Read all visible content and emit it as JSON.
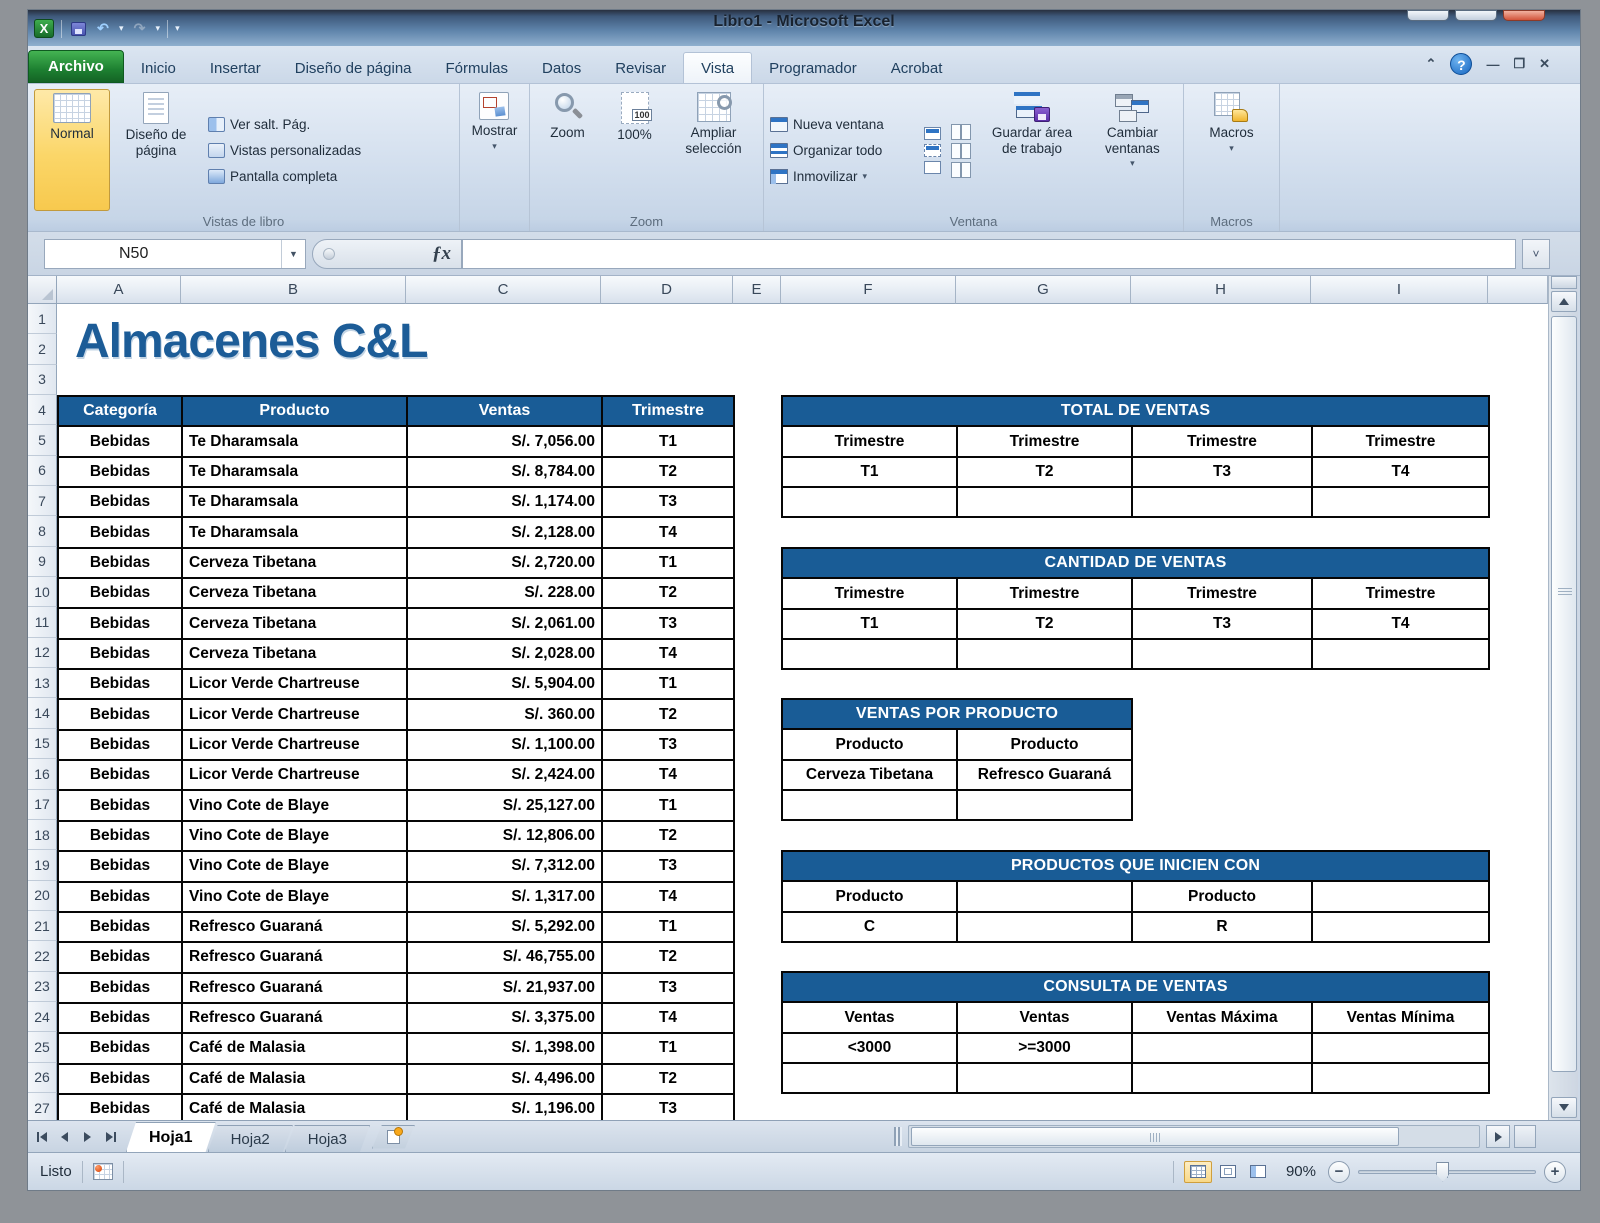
{
  "window": {
    "title": "Libro1 - Microsoft Excel"
  },
  "ribbon": {
    "tabs": [
      "Archivo",
      "Inicio",
      "Insertar",
      "Diseño de página",
      "Fórmulas",
      "Datos",
      "Revisar",
      "Vista",
      "Programador",
      "Acrobat"
    ],
    "active_tab": "Vista",
    "vistas_group": {
      "label": "Vistas de libro",
      "normal": "Normal",
      "diseno": "Diseño de página",
      "ver_salt": "Ver salt. Pág.",
      "vistas_pers": "Vistas personalizadas",
      "pantalla": "Pantalla completa"
    },
    "mostrar_group": {
      "button": "Mostrar"
    },
    "zoom_group": {
      "label": "Zoom",
      "zoom": "Zoom",
      "pct": "100%",
      "ampliar": "Ampliar selección"
    },
    "ventana_group": {
      "label": "Ventana",
      "nueva": "Nueva ventana",
      "organizar": "Organizar todo",
      "inmovilizar": "Inmovilizar",
      "guardar": "Guardar área de trabajo",
      "cambiar": "Cambiar ventanas"
    },
    "macros_group": {
      "label": "Macros",
      "button": "Macros"
    }
  },
  "formula_bar": {
    "name_box": "N50",
    "fx": "ƒx",
    "formula_value": ""
  },
  "grid": {
    "columns": [
      "A",
      "B",
      "C",
      "D",
      "E",
      "F",
      "G",
      "H",
      "I"
    ],
    "row_numbers": [
      1,
      2,
      3,
      4,
      5,
      6,
      7,
      8,
      9,
      10,
      11,
      12,
      13,
      14,
      15,
      16,
      17,
      18,
      19,
      20,
      21,
      22,
      23,
      24,
      25,
      26,
      27
    ]
  },
  "sheet": {
    "title": "Almacenes C&L",
    "main_table": {
      "columns": [
        "Categoría",
        "Producto",
        "Ventas",
        "Trimestre"
      ],
      "rows": [
        [
          "Bebidas",
          "Te Dharamsala",
          "S/. 7,056.00",
          "T1"
        ],
        [
          "Bebidas",
          "Te Dharamsala",
          "S/. 8,784.00",
          "T2"
        ],
        [
          "Bebidas",
          "Te Dharamsala",
          "S/. 1,174.00",
          "T3"
        ],
        [
          "Bebidas",
          "Te Dharamsala",
          "S/. 2,128.00",
          "T4"
        ],
        [
          "Bebidas",
          "Cerveza Tibetana",
          "S/. 2,720.00",
          "T1"
        ],
        [
          "Bebidas",
          "Cerveza Tibetana",
          "S/. 228.00",
          "T2"
        ],
        [
          "Bebidas",
          "Cerveza Tibetana",
          "S/. 2,061.00",
          "T3"
        ],
        [
          "Bebidas",
          "Cerveza Tibetana",
          "S/. 2,028.00",
          "T4"
        ],
        [
          "Bebidas",
          "Licor Verde Chartreuse",
          "S/. 5,904.00",
          "T1"
        ],
        [
          "Bebidas",
          "Licor Verde Chartreuse",
          "S/. 360.00",
          "T2"
        ],
        [
          "Bebidas",
          "Licor Verde Chartreuse",
          "S/. 1,100.00",
          "T3"
        ],
        [
          "Bebidas",
          "Licor Verde Chartreuse",
          "S/. 2,424.00",
          "T4"
        ],
        [
          "Bebidas",
          "Vino Cote de Blaye",
          "S/. 25,127.00",
          "T1"
        ],
        [
          "Bebidas",
          "Vino Cote de Blaye",
          "S/. 12,806.00",
          "T2"
        ],
        [
          "Bebidas",
          "Vino Cote de Blaye",
          "S/. 7,312.00",
          "T3"
        ],
        [
          "Bebidas",
          "Vino Cote de Blaye",
          "S/. 1,317.00",
          "T4"
        ],
        [
          "Bebidas",
          "Refresco Guaraná",
          "S/. 5,292.00",
          "T1"
        ],
        [
          "Bebidas",
          "Refresco Guaraná",
          "S/. 46,755.00",
          "T2"
        ],
        [
          "Bebidas",
          "Refresco Guaraná",
          "S/. 21,937.00",
          "T3"
        ],
        [
          "Bebidas",
          "Refresco Guaraná",
          "S/. 3,375.00",
          "T4"
        ],
        [
          "Bebidas",
          "Café de Malasia",
          "S/. 1,398.00",
          "T1"
        ],
        [
          "Bebidas",
          "Café de Malasia",
          "S/. 4,496.00",
          "T2"
        ],
        [
          "Bebidas",
          "Café de Malasia",
          "S/. 1,196.00",
          "T3"
        ]
      ]
    },
    "total_de_ventas": {
      "title": "TOTAL DE VENTAS",
      "columns": [
        "Trimestre",
        "Trimestre",
        "Trimestre",
        "Trimestre"
      ],
      "rows": [
        [
          "T1",
          "T2",
          "T3",
          "T4"
        ],
        [
          "",
          "",
          "",
          ""
        ]
      ]
    },
    "cantidad_de_ventas": {
      "title": "CANTIDAD DE VENTAS",
      "columns": [
        "Trimestre",
        "Trimestre",
        "Trimestre",
        "Trimestre"
      ],
      "rows": [
        [
          "T1",
          "T2",
          "T3",
          "T4"
        ],
        [
          "",
          "",
          "",
          ""
        ]
      ]
    },
    "ventas_por_producto": {
      "title": "VENTAS POR PRODUCTO",
      "columns": [
        "Producto",
        "Producto"
      ],
      "rows": [
        [
          "Cerveza Tibetana",
          "Refresco Guaraná"
        ],
        [
          "",
          ""
        ]
      ]
    },
    "productos_que_inicien_con": {
      "title": "PRODUCTOS QUE INICIEN CON",
      "columns": [
        "Producto",
        "",
        "Producto",
        ""
      ],
      "rows": [
        [
          "C",
          "",
          "R",
          ""
        ]
      ]
    },
    "consulta_de_ventas": {
      "title": "CONSULTA DE VENTAS",
      "columns": [
        "Ventas",
        "Ventas",
        "Ventas Máxima",
        "Ventas Mínima"
      ],
      "rows": [
        [
          "<3000",
          ">=3000",
          "",
          ""
        ],
        [
          "",
          "",
          "",
          ""
        ]
      ]
    }
  },
  "sheet_tabs": {
    "tabs": [
      "Hoja1",
      "Hoja2",
      "Hoja3"
    ],
    "active": "Hoja1"
  },
  "status_bar": {
    "status": "Listo",
    "zoom_level": "90%"
  },
  "colors": {
    "table_header_blue": "#195C96",
    "archivo_green": "#1D8031",
    "selected_view_highlight": "#FBD668"
  }
}
